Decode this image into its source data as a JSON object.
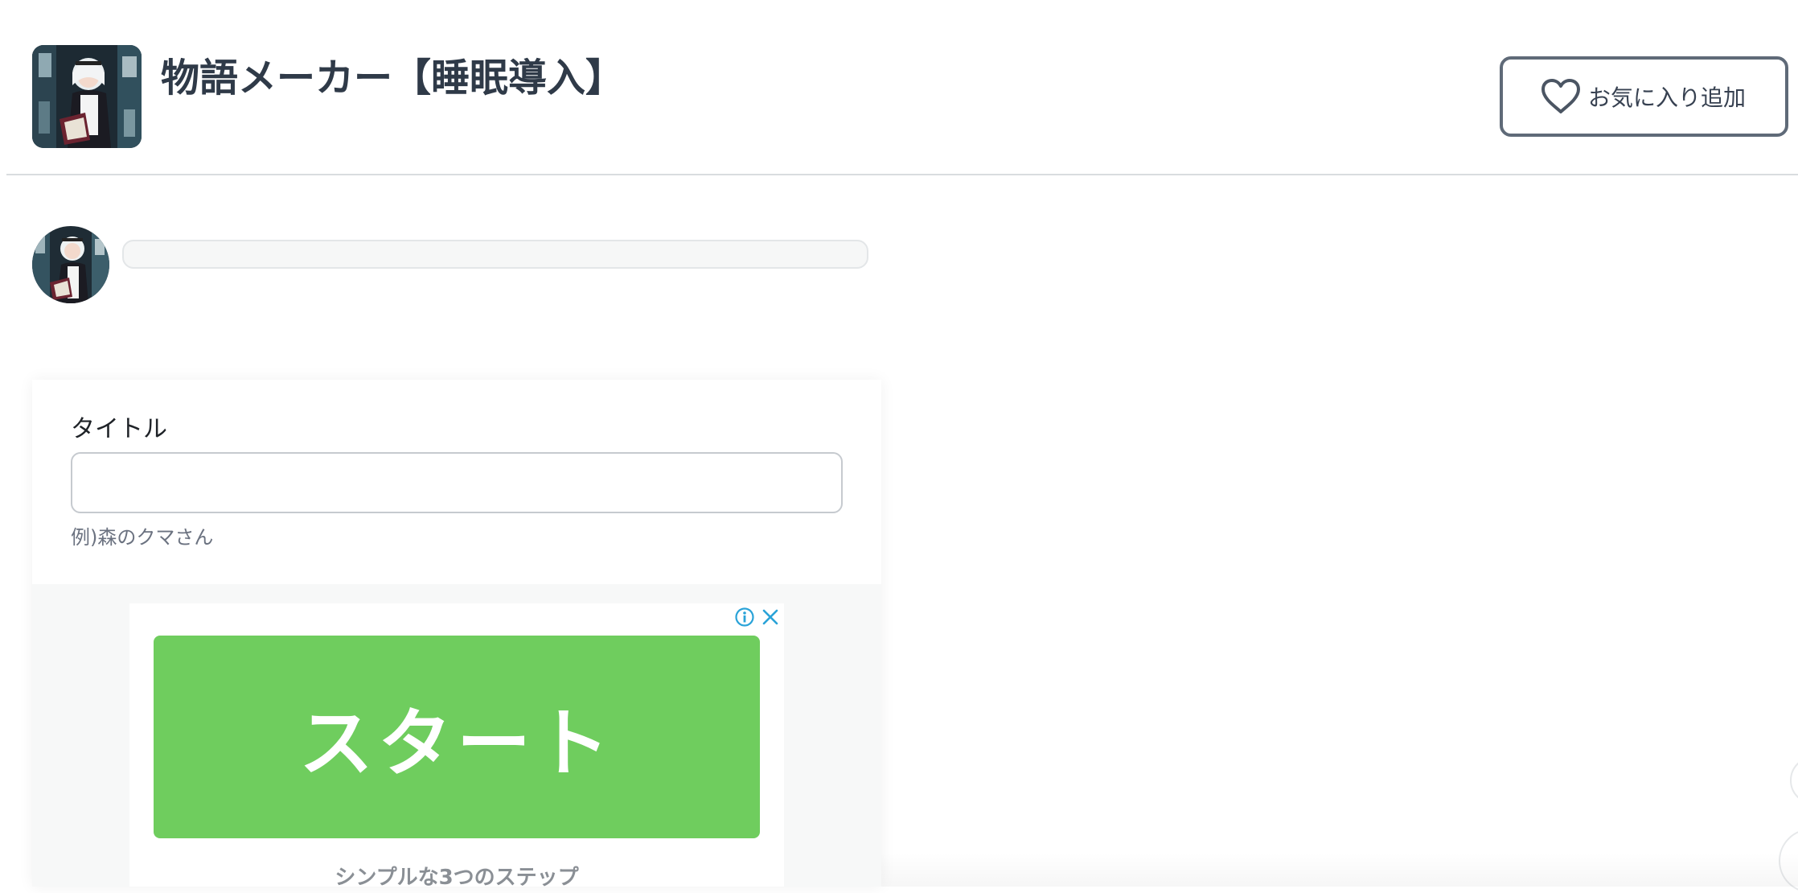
{
  "header": {
    "title": "物語メーカー【睡眠導入】",
    "favorite_button_label": "お気に入り追加",
    "app_icon": "maid-reading-book-image"
  },
  "chat": {
    "avatar": "maid-reading-book-avatar",
    "message": ""
  },
  "form": {
    "title_label": "タイトル",
    "title_value": "",
    "title_help": "例)森のクマさん"
  },
  "ad": {
    "start_label": "スタート",
    "caption": "シンプルな3つのステップ",
    "start_color": "#6fcd5e",
    "icon_color": "#2aa3d8"
  },
  "colors": {
    "title_text": "#2f3a48",
    "button_border": "#5f6a78",
    "divider": "#d9dcdf"
  }
}
